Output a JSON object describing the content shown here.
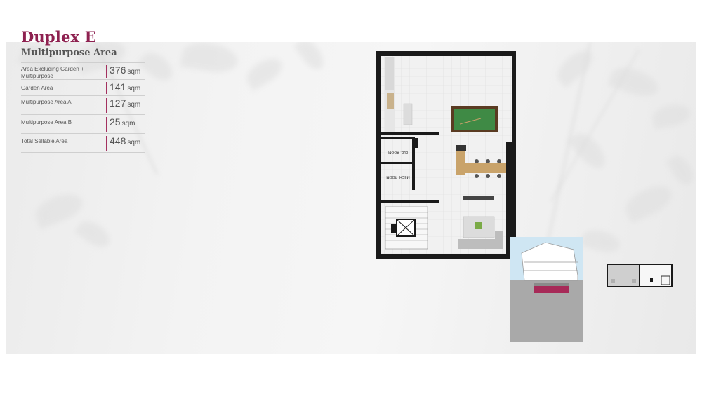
{
  "title": "Duplex E",
  "subtitle": "Multipurpose Area",
  "areas": [
    {
      "label": "Area Excluding Garden + Multipurpose",
      "value": "376",
      "unit": "sqm"
    },
    {
      "label": "Garden Area",
      "value": "141",
      "unit": "sqm"
    },
    {
      "label": "Multipurpose Area A",
      "value": "127",
      "unit": "sqm"
    },
    {
      "label": "Multipurpose Area B",
      "value": "25",
      "unit": "sqm"
    },
    {
      "label": "Total Sellable Area",
      "value": "448",
      "unit": "sqm"
    }
  ],
  "plan": {
    "room1_label": "ELE. ROOM",
    "room2_label": "MECH. ROOM"
  },
  "colors": {
    "accent": "#8e2150",
    "billiard_felt": "#3f8a45",
    "plan_wall": "#1a1a1a",
    "section_highlight": "#a72a58"
  }
}
